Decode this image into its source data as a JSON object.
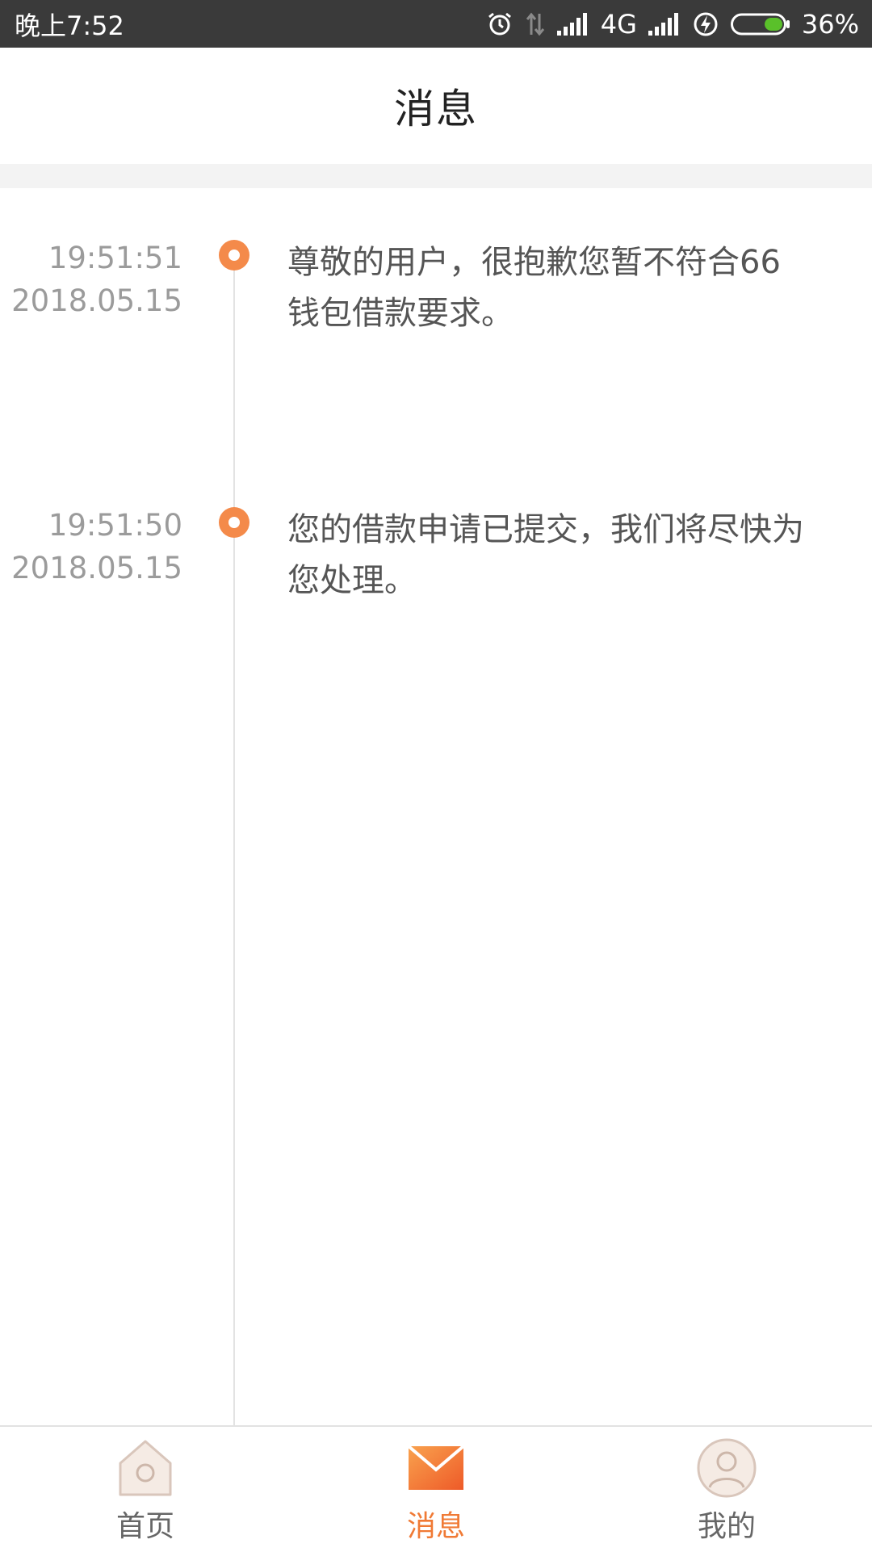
{
  "status_bar": {
    "time": "晚上7:52",
    "network": "4G",
    "battery_percent": "36%",
    "battery_level": 0.36,
    "icons": [
      "alarm-icon",
      "data-arrows-icon",
      "signal-icon",
      "signal-icon",
      "charging-icon",
      "battery-icon"
    ]
  },
  "header": {
    "title": "消息"
  },
  "messages": [
    {
      "time": "19:51:51",
      "date": "2018.05.15",
      "text": "尊敬的用户，很抱歉您暂不符合66钱包借款要求。"
    },
    {
      "time": "19:51:50",
      "date": "2018.05.15",
      "text": "您的借款申请已提交，我们将尽快为您处理。"
    }
  ],
  "bottom_nav": {
    "items": [
      {
        "label": "首页",
        "icon": "home-icon",
        "active": false
      },
      {
        "label": "消息",
        "icon": "mail-icon",
        "active": true
      },
      {
        "label": "我的",
        "icon": "user-icon",
        "active": false
      }
    ]
  },
  "colors": {
    "accent": "#f07a35",
    "dot": "#f48a4a",
    "status_bar_bg": "#3a3a3a",
    "battery_fill": "#5ac02a"
  }
}
